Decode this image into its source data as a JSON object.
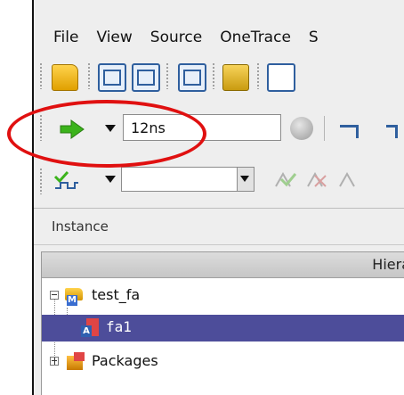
{
  "menubar": {
    "items": [
      {
        "label": "File",
        "name": "menu-file"
      },
      {
        "label": "View",
        "name": "menu-view"
      },
      {
        "label": "Source",
        "name": "menu-source"
      },
      {
        "label": "OneTrace",
        "name": "menu-onetrace"
      },
      {
        "label": "S",
        "name": "menu-s"
      }
    ]
  },
  "simulation": {
    "run_time_value": "12ns"
  },
  "panel": {
    "label": "Instance",
    "column_header": "Hiera"
  },
  "tree": {
    "items": [
      {
        "label": "test_fa",
        "expander": "minus",
        "icon": "module-icon"
      },
      {
        "label": "fa1",
        "icon": "instance-icon",
        "selected": true
      },
      {
        "label": "Packages",
        "expander": "plus",
        "icon": "package-icon"
      }
    ]
  },
  "annotation": {
    "color": "#e01010"
  },
  "colors": {
    "selection": "#4d4d9a",
    "accent_green": "#3bb31b"
  }
}
